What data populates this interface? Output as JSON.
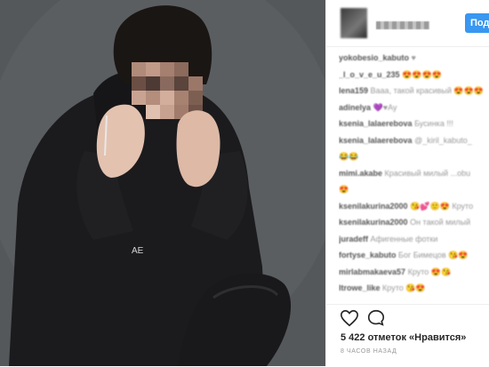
{
  "post": {
    "photo_alt": "Blurred portrait of a person in a black hoodie"
  },
  "header": {
    "username": "username",
    "follow_label": "Подп"
  },
  "comments": [
    {
      "user": "yokobesio_kabuto",
      "text": "♥"
    },
    {
      "user": "_l_o_v_e_u_235",
      "text": "😍😍😍😍"
    },
    {
      "user": "lena159",
      "text": "Вааа, такой красивый 😍😍😍"
    },
    {
      "user": "adinelya",
      "text": "💜♥Ау"
    },
    {
      "user": "ksenia_lalaerebova",
      "text": "Бусинка !!!"
    },
    {
      "user": "ksenia_lalaerebova",
      "text": "@_kiril_kabuto_"
    },
    {
      "user": "",
      "text": "😂😂"
    },
    {
      "user": "mimi.akabe",
      "text": "Красивый милый ...obu"
    },
    {
      "user": "",
      "text": "😍"
    },
    {
      "user": "ksenilakurina2000",
      "text": "😘💕🙂😍 Круто"
    },
    {
      "user": "ksenilakurina2000",
      "text": "Он такой милый"
    },
    {
      "user": "juradeff",
      "text": "Афигенные фотки"
    },
    {
      "user": "fortyse_kabuto",
      "text": "Бог Бимецов 😘😍"
    },
    {
      "user": "mirlabmakaeva57",
      "text": "Круто 😍😘"
    },
    {
      "user": "ltrowe_like",
      "text": "Круто 😘😍"
    }
  ],
  "actions": {
    "like_icon": "heart-outline-icon",
    "comment_icon": "speech-bubble-icon",
    "likes_text": "5 422 отметок «Нравится»",
    "timestamp": "8 ЧАСОВ НАЗАД"
  },
  "colors": {
    "accent": "#3897f0",
    "text": "#262626",
    "muted": "#999999"
  }
}
